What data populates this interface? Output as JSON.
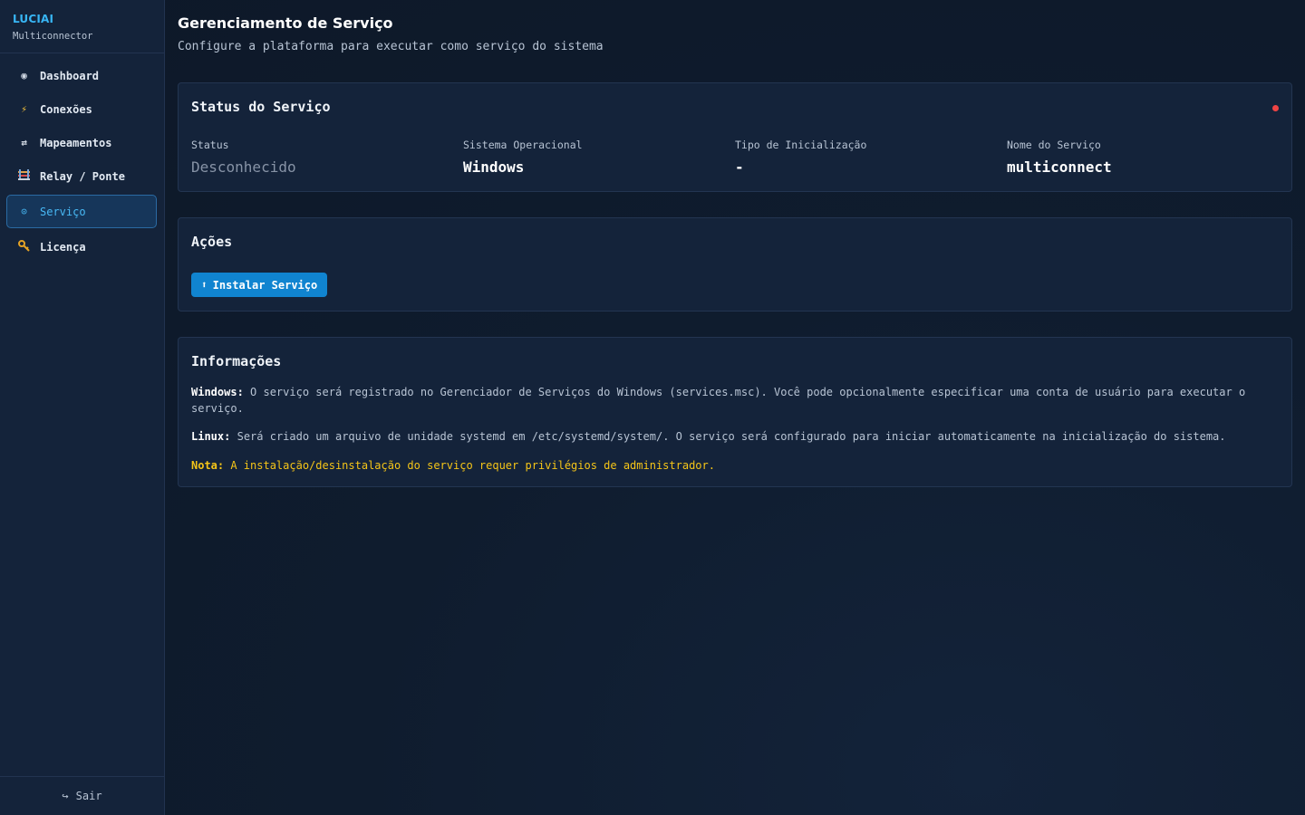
{
  "brand": {
    "title": "LUCIAI",
    "subtitle": "Multiconnector"
  },
  "nav": {
    "items": [
      {
        "label": "Dashboard",
        "icon": "dashboard-icon"
      },
      {
        "label": "Conexões",
        "icon": "bolt-icon"
      },
      {
        "label": "Mapeamentos",
        "icon": "swap-icon"
      },
      {
        "label": "Relay / Ponte",
        "icon": "relay-icon"
      },
      {
        "label": "Serviço",
        "icon": "service-icon",
        "active": true
      },
      {
        "label": "Licença",
        "icon": "key-icon"
      }
    ],
    "logout": "Sair"
  },
  "page": {
    "title": "Gerenciamento de Serviço",
    "subtitle": "Configure a plataforma para executar como serviço do sistema"
  },
  "status": {
    "title": "Status do Serviço",
    "indicator_color": "#ef4444",
    "fields": [
      {
        "label": "Status",
        "value": "Desconhecido"
      },
      {
        "label": "Sistema Operacional",
        "value": "Windows"
      },
      {
        "label": "Tipo de Inicialização",
        "value": "-"
      },
      {
        "label": "Nome do Serviço",
        "value": "multiconnect"
      }
    ]
  },
  "actions": {
    "title": "Ações",
    "install_icon": "⬆",
    "install_label": "Instalar Serviço"
  },
  "info": {
    "title": "Informações",
    "windows_label": "Windows:",
    "windows_text": "O serviço será registrado no Gerenciador de Serviços do Windows (services.msc). Você pode opcionalmente especificar uma conta de usuário para executar o serviço.",
    "linux_label": "Linux:",
    "linux_text": "Será criado um arquivo de unidade systemd em /etc/systemd/system/. O serviço será configurado para iniciar automaticamente na inicialização do sistema.",
    "note_label": "Nota:",
    "note_text": "A instalação/desinstalação do serviço requer privilégios de administrador."
  },
  "colors": {
    "accent": "#38b6f5",
    "primary_button": "#1084d0",
    "warning": "#f5c518",
    "background": "#0f1b2d",
    "card": "#14233a"
  }
}
